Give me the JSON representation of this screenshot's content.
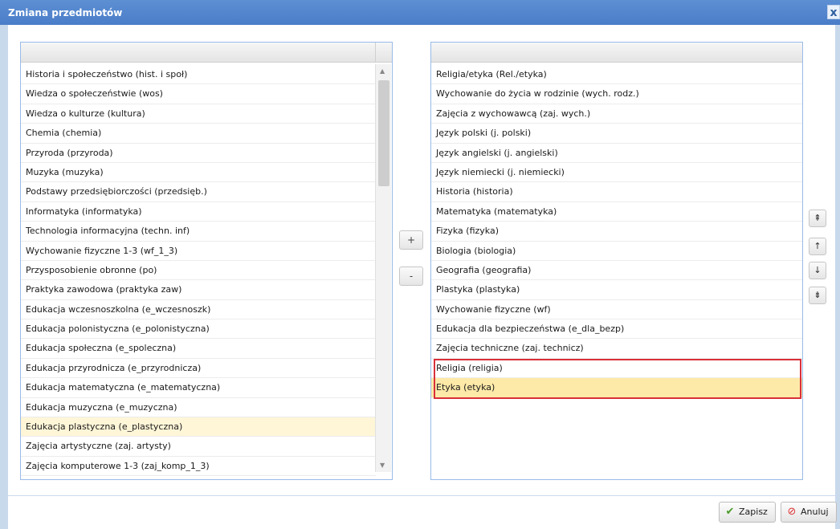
{
  "window": {
    "title": "Zmiana przedmiotów",
    "close_label": "x"
  },
  "left_list": {
    "items": [
      "Historia i społeczeństwo (hist. i społ)",
      "Wiedza o społeczeństwie (wos)",
      "Wiedza o kulturze (kultura)",
      "Chemia (chemia)",
      "Przyroda (przyroda)",
      "Muzyka (muzyka)",
      "Podstawy przedsiębiorczości (przedsięb.)",
      "Informatyka (informatyka)",
      "Technologia informacyjna (techn. inf)",
      "Wychowanie fizyczne 1-3 (wf_1_3)",
      "Przysposobienie obronne (po)",
      "Praktyka zawodowa (praktyka zaw)",
      "Edukacja wczesnoszkolna (e_wczesnoszk)",
      "Edukacja polonistyczna (e_polonistyczna)",
      "Edukacja społeczna (e_spoleczna)",
      "Edukacja przyrodnicza (e_przyrodnicza)",
      "Edukacja matematyczna (e_matematyczna)",
      "Edukacja muzyczna (e_muzyczna)",
      "Edukacja plastyczna (e_plastyczna)",
      "Zajęcia artystyczne (zaj. artysty)",
      "Zajęcia komputerowe 1-3 (zaj_komp_1_3)"
    ],
    "selected_item": "Edukacja plastyczna (e_plastyczna)"
  },
  "right_list": {
    "items": [
      "Religia/etyka (Rel./etyka)",
      "Wychowanie do życia w rodzinie (wych. rodz.)",
      "Zajęcia z wychowawcą (zaj. wych.)",
      "Język polski (j. polski)",
      "Język angielski (j. angielski)",
      "Język niemiecki (j. niemiecki)",
      "Historia (historia)",
      "Matematyka (matematyka)",
      "Fizyka (fizyka)",
      "Biologia (biologia)",
      "Geografia (geografia)",
      "Plastyka (plastyka)",
      "Wychowanie fizyczne (wf)",
      "Edukacja dla bezpieczeństwa (e_dla_bezp)",
      "Zajęcia techniczne (zaj. technicz)",
      "Religia (religia)",
      "Etyka (etyka)"
    ],
    "selected_item": "Etyka (etyka)"
  },
  "transfer_buttons": {
    "add_label": "+",
    "remove_label": "-"
  },
  "order_buttons": {
    "top": "⇞",
    "up": "↑",
    "down": "↓",
    "bottom": "⇟"
  },
  "footer": {
    "save_label": "Zapisz",
    "cancel_label": "Anuluj"
  },
  "icons": {
    "save": "checkmark-icon",
    "cancel": "no-entry-icon"
  },
  "colors": {
    "title_bar": "#4a7dc8",
    "selection": "#fde9a8",
    "highlight_border": "#d9303a"
  }
}
